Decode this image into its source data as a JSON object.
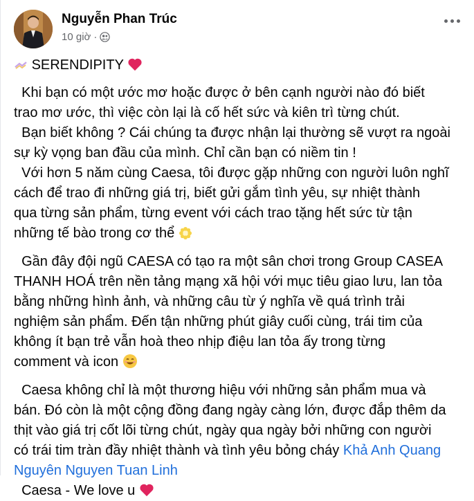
{
  "author": {
    "name": "Nguyễn Phan Trúc"
  },
  "meta": {
    "time": "10 giờ",
    "separator": "·",
    "audience_icon": "friends-icon"
  },
  "post": {
    "title": "SERENDIPITY",
    "p1_lines": [
      "  Khi bạn có một ước mơ hoặc được ở bên cạnh người nào đó biết",
      "trao mơ ước, thì việc còn lại là cố hết sức và kiên trì từng chút.",
      "  Bạn biết không ? Cái chúng ta được nhận lại thường sẽ vượt ra ngoài",
      "sự kỳ vọng ban đầu của mình. Chỉ cần bạn có niềm tin !",
      "  Với hơn 5 năm cùng Caesa, tôi được gặp những con người luôn nghĩ",
      "cách để trao đi những giá trị, biết gửi gắm tình yêu, sự nhiệt thành",
      "qua từng sản phẩm, từng event với cách trao tặng hết sức từ tận",
      "những tế bào trong cơ thể"
    ],
    "p2_lines": [
      "  Gần đây đội ngũ CAESA có tạo ra một sân chơi trong Group CASEA",
      "THANH HOÁ trên nền tảng mạng xã hội với mục tiêu giao lưu, lan tỏa",
      "bằng những hình ảnh, và những câu từ ý nghĩa về quá trình trải",
      "nghiệm sản phẩm. Đến tận những phút giây cuối cùng, trái tim của",
      "không ít bạn trẻ vẫn hoà theo nhịp điệu lan tỏa ấy trong từng",
      "comment và icon"
    ],
    "p3_lines": [
      "  Caesa không chỉ là một thương hiệu với những sản phẩm mua và",
      "bán. Đó còn là một cộng đồng đang ngày càng lớn, được đắp thêm da",
      "thịt vào giá trị cốt lõi từng chút, ngày qua ngày bởi những con người",
      "có trái tim tràn đầy nhiệt thành và tình yêu bỏng cháy"
    ],
    "tag1": "Khả Anh Quang",
    "tag2": "Nguyên Nguyen Tuan Linh",
    "closing": "  Caesa - We love u"
  },
  "colors": {
    "link": "#216fdb",
    "heart": "#e0245e",
    "muted": "#65676b"
  }
}
